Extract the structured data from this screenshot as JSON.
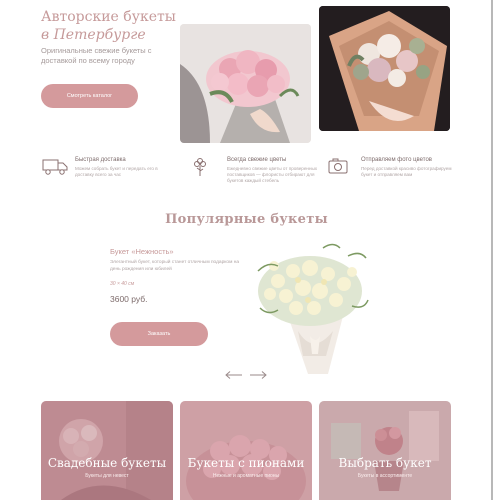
{
  "hero": {
    "title_line1": "Авторские букеты",
    "title_line2": "в Петербурге",
    "subtitle": "Оригинальные свежие букеты с доставкой по всему городу",
    "button_label": "Смотреть каталог"
  },
  "features": [
    {
      "icon": "truck-icon",
      "title": "Быстрая доставка",
      "desc": "Можем собрать букет и передать его в доставку всего за час"
    },
    {
      "icon": "flower-icon",
      "title": "Всегда свежие цветы",
      "desc": "Ежедневно свежие цветы от проверенных поставщиков — флористы отбирают для букетов каждый стебель"
    },
    {
      "icon": "photo-icon",
      "title": "Отправляем фото цветов",
      "desc": "Перед доставкой красиво фотографируем букет и отправляем вам"
    }
  ],
  "popular": {
    "title": "Популярные букеты",
    "product_name": "Букет «Нежность»",
    "product_desc": "Элегантный букет, который станет отличным подарком на день рождения или юбилей",
    "product_size": "30 × 40 см",
    "product_price": "3600 руб.",
    "order_label": "Заказать"
  },
  "categories": [
    {
      "title": "Свадебные букеты",
      "subtitle": "Букеты для невест"
    },
    {
      "title": "Букеты с пионами",
      "subtitle": "Нежные и ароматные пионы"
    },
    {
      "title": "Выбрать букет",
      "subtitle": "Букеты в ассортименте"
    }
  ],
  "colors": {
    "accent": "#d49a9c",
    "heading": "#c69a9a",
    "text": "#7d6b6b"
  }
}
